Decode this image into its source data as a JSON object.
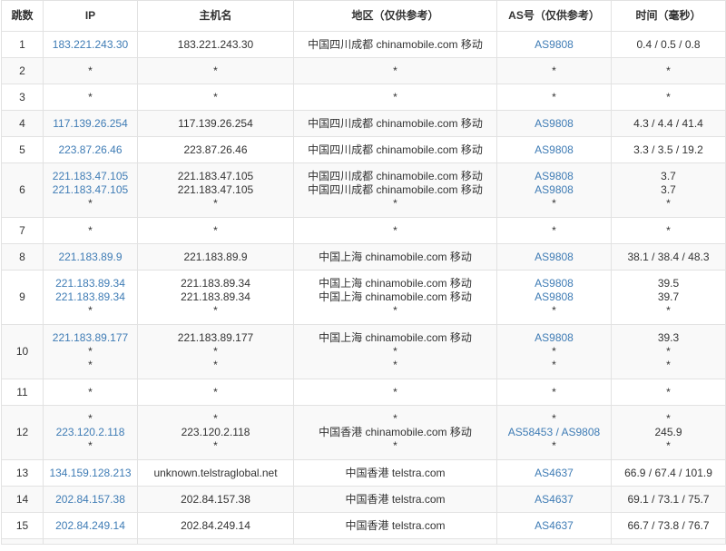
{
  "headers": {
    "hop": "跳数",
    "ip": "IP",
    "hostname": "主机名",
    "region": "地区（仅供参考）",
    "as": "AS号（仅供参考）",
    "time": "时间（毫秒）"
  },
  "rows": [
    {
      "hop": "1",
      "ips": [
        "183.221.243.30"
      ],
      "hosts": [
        "183.221.243.30"
      ],
      "regions": [
        "中国四川成都 chinamobile.com 移动"
      ],
      "asns": [
        "AS9808"
      ],
      "times": [
        "0.4 / 0.5 / 0.8"
      ]
    },
    {
      "hop": "2",
      "ips": [
        "*"
      ],
      "hosts": [
        "*"
      ],
      "regions": [
        "*"
      ],
      "asns": [
        "*"
      ],
      "times": [
        "*"
      ]
    },
    {
      "hop": "3",
      "ips": [
        "*"
      ],
      "hosts": [
        "*"
      ],
      "regions": [
        "*"
      ],
      "asns": [
        "*"
      ],
      "times": [
        "*"
      ]
    },
    {
      "hop": "4",
      "ips": [
        "117.139.26.254"
      ],
      "hosts": [
        "117.139.26.254"
      ],
      "regions": [
        "中国四川成都 chinamobile.com 移动"
      ],
      "asns": [
        "AS9808"
      ],
      "times": [
        "4.3 / 4.4 / 41.4"
      ]
    },
    {
      "hop": "5",
      "ips": [
        "223.87.26.46"
      ],
      "hosts": [
        "223.87.26.46"
      ],
      "regions": [
        "中国四川成都 chinamobile.com 移动"
      ],
      "asns": [
        "AS9808"
      ],
      "times": [
        "3.3 / 3.5 / 19.2"
      ]
    },
    {
      "hop": "6",
      "ips": [
        "221.183.47.105",
        "221.183.47.105",
        "*"
      ],
      "hosts": [
        "221.183.47.105",
        "221.183.47.105",
        "*"
      ],
      "regions": [
        "中国四川成都 chinamobile.com 移动",
        "中国四川成都 chinamobile.com 移动",
        "*"
      ],
      "asns": [
        "AS9808",
        "AS9808",
        "*"
      ],
      "times": [
        "3.7",
        "3.7",
        "*"
      ]
    },
    {
      "hop": "7",
      "ips": [
        "*"
      ],
      "hosts": [
        "*"
      ],
      "regions": [
        "*"
      ],
      "asns": [
        "*"
      ],
      "times": [
        "*"
      ]
    },
    {
      "hop": "8",
      "ips": [
        "221.183.89.9"
      ],
      "hosts": [
        "221.183.89.9"
      ],
      "regions": [
        "中国上海 chinamobile.com 移动"
      ],
      "asns": [
        "AS9808"
      ],
      "times": [
        "38.1 / 38.4 / 48.3"
      ]
    },
    {
      "hop": "9",
      "ips": [
        "221.183.89.34",
        "221.183.89.34",
        "*"
      ],
      "hosts": [
        "221.183.89.34",
        "221.183.89.34",
        "*"
      ],
      "regions": [
        "中国上海 chinamobile.com 移动",
        "中国上海 chinamobile.com 移动",
        "*"
      ],
      "asns": [
        "AS9808",
        "AS9808",
        "*"
      ],
      "times": [
        "39.5",
        "39.7",
        "*"
      ]
    },
    {
      "hop": "10",
      "ips": [
        "221.183.89.177",
        "*",
        "*"
      ],
      "hosts": [
        "221.183.89.177",
        "*",
        "*"
      ],
      "regions": [
        "中国上海 chinamobile.com 移动",
        "*",
        "*"
      ],
      "asns": [
        "AS9808",
        "*",
        "*"
      ],
      "times": [
        "39.3",
        "*",
        "*"
      ]
    },
    {
      "hop": "11",
      "ips": [
        "*"
      ],
      "hosts": [
        "*"
      ],
      "regions": [
        "*"
      ],
      "asns": [
        "*"
      ],
      "times": [
        "*"
      ]
    },
    {
      "hop": "12",
      "ips": [
        "*",
        "223.120.2.118",
        "*"
      ],
      "hosts": [
        "*",
        "223.120.2.118",
        "*"
      ],
      "regions": [
        "*",
        "中国香港 chinamobile.com 移动",
        "*"
      ],
      "asns": [
        "*",
        "AS58453 / AS9808",
        "*"
      ],
      "times": [
        "*",
        "245.9",
        "*"
      ]
    },
    {
      "hop": "13",
      "ips": [
        "134.159.128.213"
      ],
      "hosts": [
        "unknown.telstraglobal.net"
      ],
      "regions": [
        "中国香港 telstra.com"
      ],
      "asns": [
        "AS4637"
      ],
      "times": [
        "66.9 / 67.4 / 101.9"
      ]
    },
    {
      "hop": "14",
      "ips": [
        "202.84.157.38"
      ],
      "hosts": [
        "202.84.157.38"
      ],
      "regions": [
        "中国香港 telstra.com"
      ],
      "asns": [
        "AS4637"
      ],
      "times": [
        "69.1 / 73.1 / 75.7"
      ]
    },
    {
      "hop": "15",
      "ips": [
        "202.84.249.14"
      ],
      "hosts": [
        "202.84.249.14"
      ],
      "regions": [
        "中国香港 telstra.com"
      ],
      "asns": [
        "AS4637"
      ],
      "times": [
        "66.7 / 73.8 / 76.7"
      ]
    },
    {
      "hop": "",
      "ips": [
        ""
      ],
      "hosts": [
        ""
      ],
      "regions": [
        ""
      ],
      "asns": [
        ""
      ],
      "times": [
        ""
      ]
    }
  ],
  "colors": {
    "link": "#3f7cb5",
    "text": "#333333",
    "border": "#e2e2e2",
    "stripe": "#f9f9f9"
  }
}
